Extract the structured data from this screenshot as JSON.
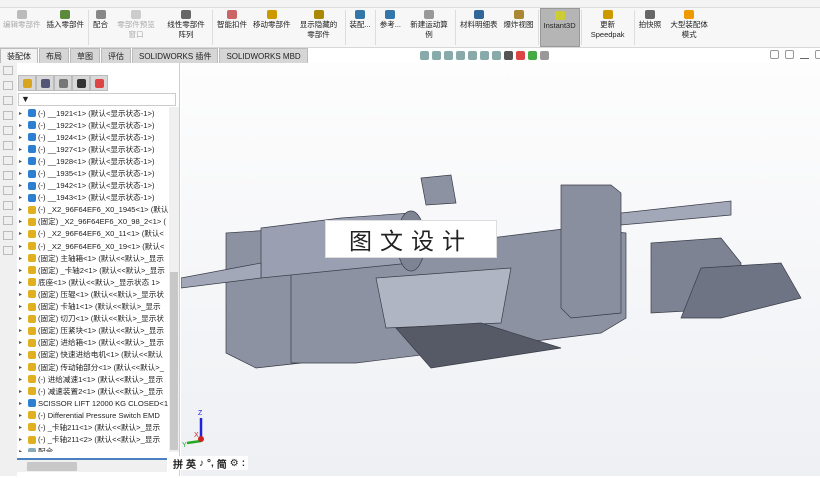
{
  "command_manager": [
    {
      "label": "编辑零部件",
      "disabled": true,
      "color": "#bbb"
    },
    {
      "label": "插入零部件",
      "color": "#5a8a3a"
    },
    {
      "label": "配合",
      "color": "#888"
    },
    {
      "label": "零部件预览窗口",
      "disabled": true,
      "color": "#ccc"
    },
    {
      "label": "线性零部件阵列",
      "color": "#666"
    },
    {
      "label": "智能扣件",
      "color": "#c66"
    },
    {
      "label": "移动零部件",
      "color": "#c90"
    },
    {
      "label": "显示隐藏的零部件",
      "color": "#a80"
    },
    {
      "label": "装配...",
      "color": "#37a"
    },
    {
      "label": "参考...",
      "color": "#37a"
    },
    {
      "label": "新建运动算例",
      "color": "#999"
    },
    {
      "label": "材料明细表",
      "color": "#369"
    },
    {
      "label": "爆炸视图",
      "color": "#a83"
    },
    {
      "label": "Instant3D",
      "active": true,
      "color": "#cc3"
    },
    {
      "label": "更新Speedpak",
      "color": "#c90"
    },
    {
      "label": "拍快照",
      "color": "#666"
    },
    {
      "label": "大型装配体模式",
      "color": "#e90"
    }
  ],
  "tabs": [
    "装配体",
    "布局",
    "草图",
    "评估",
    "SOLIDWORKS 插件",
    "SOLIDWORKS MBD"
  ],
  "panel_tabs": [
    "feature-manager",
    "property-manager",
    "configuration-manager",
    "dimxpert",
    "display-manager"
  ],
  "tree": [
    "(-) __1921<1> (默认<显示状态-1>)",
    "(-) __1922<1> (默认<显示状态-1>)",
    "(-) __1924<1> (默认<显示状态-1>)",
    "(-) __1927<1> (默认<显示状态-1>)",
    "(-) __1928<1> (默认<显示状态-1>)",
    "(-) __1935<1> (默认<显示状态-1>)",
    "(-) __1942<1> (默认<显示状态-1>)",
    "(-) __1943<1> (默认<显示状态-1>)",
    "(-) _X2_96F64EF6_X0_1945<1> (默认",
    "(固定) _X2_96F64EF6_X0_98_2<1> (",
    "(-) _X2_96F64EF6_X0_11<1> (默认<",
    "(-) _X2_96F64EF6_X0_19<1> (默认<",
    "(固定) 主轴箱<1> (默认<<默认>_显示",
    "(固定) _卡轴2<1> (默认<<默认>_显示",
    "底座<1> (默认<<默认>_显示状态 1>",
    "(固定) 压辊<1> (默认<<默认>_显示状",
    "(固定) 卡轴1<1> (默认<<默认>_显示",
    "(固定) 切刀<1> (默认<<默认>_显示状",
    "(固定) 压紧块<1> (默认<<默认>_显示",
    "(固定) 进给箱<1> (默认<<默认>_显示",
    "(固定) 快速进给电机<1> (默认<<默认",
    "(固定) 传动轴部分<1> (默认<<默认>_",
    "(-) 进给减速1<1> (默认<<默认>_显示",
    "(-) 减速装置2<1> (默认<<默认>_显示",
    "SCISSOR LIFT 12000 KG CLOSED<1",
    "(-) Differential Pressure Switch EMD",
    "(-) _卡轴211<1> (默认<<默认>_显示",
    "(-) _卡轴211<2> (默认<<默认>_显示",
    "配合"
  ],
  "watermark": "图文设计",
  "ime": [
    "拼",
    "英",
    "♪",
    "°,",
    "简",
    "⚙",
    ":"
  ],
  "axes": {
    "x": "X",
    "y": "Y",
    "z": "Z"
  }
}
